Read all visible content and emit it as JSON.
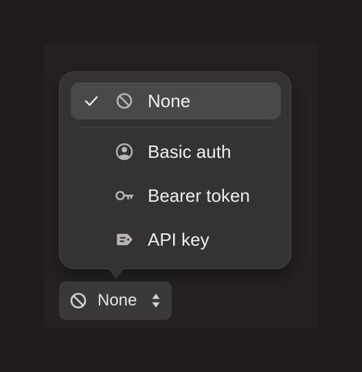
{
  "menu": {
    "items": [
      {
        "label": "None",
        "icon": "none-icon",
        "selected": true
      },
      {
        "label": "Basic auth",
        "icon": "user-circle-icon",
        "selected": false
      },
      {
        "label": "Bearer token",
        "icon": "key-icon",
        "selected": false
      },
      {
        "label": "API key",
        "icon": "tag-icon",
        "selected": false
      }
    ]
  },
  "trigger": {
    "label": "None",
    "icon": "none-icon",
    "chevron_icon": "chevron-up-down-icon"
  },
  "colors": {
    "background": "#1f1c1b",
    "panel": "#343233",
    "selected": "#4a4849",
    "text": "#f1efee",
    "icon": "#b8b5b4"
  }
}
